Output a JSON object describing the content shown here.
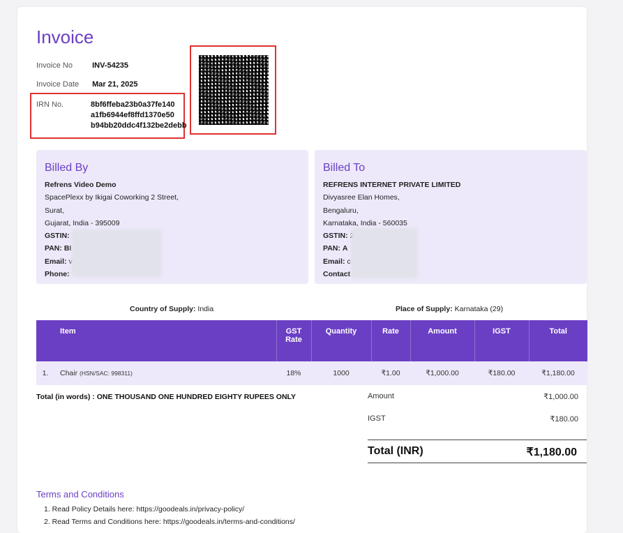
{
  "invoice": {
    "title": "Invoice",
    "invoice_no_label": "Invoice No",
    "invoice_no": "INV-54235",
    "invoice_date_label": "Invoice Date",
    "invoice_date": "Mar 21, 2025",
    "irn_label": "IRN No.",
    "irn_lines": [
      "8bf6ffeba23b0a37fe140",
      "a1fb6944ef8ffd1370e50",
      "b94bb20ddc4f132be2debb"
    ]
  },
  "billed_by": {
    "title": "Billed By",
    "name": "Refrens Video Demo",
    "address": [
      "SpacePlexx by Ikigai Coworking 2 Street,",
      "Surat,",
      "Gujarat, India - 395009"
    ],
    "gstin_label": "GSTIN:",
    "pan_label": "PAN:",
    "pan_partial": "BI",
    "email_label": "Email:",
    "email_partial": "v",
    "phone_label": "Phone:"
  },
  "billed_to": {
    "title": "Billed To",
    "name": "REFRENS INTERNET PRIVATE LIMITED",
    "address": [
      "Divyasree Elan Homes,",
      "Bengaluru,",
      "Karnataka, India - 560035"
    ],
    "gstin_label": "GSTIN:",
    "gstin_partial": "2",
    "pan_label": "PAN:",
    "pan_partial": "A",
    "email_label": "Email:",
    "email_partial": "c",
    "contact_label": "Contact"
  },
  "supply": {
    "country_label": "Country of Supply:",
    "country": "India",
    "place_label": "Place of Supply:",
    "place": "Karnataka (29)"
  },
  "table": {
    "headers": [
      "Item",
      "GST Rate",
      "Quantity",
      "Rate",
      "Amount",
      "IGST",
      "Total"
    ],
    "rows": [
      {
        "no": "1.",
        "item": "Chair",
        "hsn": "(HSN/SAC: 998311)",
        "gst_rate": "18%",
        "quantity": "1000",
        "rate": "₹1.00",
        "amount": "₹1,000.00",
        "igst": "₹180.00",
        "total": "₹1,180.00"
      }
    ]
  },
  "totals": {
    "words": "Total (in words) : ONE THOUSAND ONE HUNDRED EIGHTY RUPEES ONLY",
    "amount_label": "Amount",
    "amount": "₹1,000.00",
    "igst_label": "IGST",
    "igst": "₹180.00",
    "total_label": "Total (INR)",
    "total": "₹1,180.00"
  },
  "terms": {
    "title": "Terms and Conditions",
    "items": [
      "1. Read Policy Details here: https://goodeals.in/privacy-policy/",
      "2. Read Terms and Conditions here: https://goodeals.in/terms-and-conditions/"
    ]
  },
  "colors": {
    "accent": "#6b3fc4",
    "card_bg": "#ede9fa",
    "highlight_box": "#e03030"
  }
}
